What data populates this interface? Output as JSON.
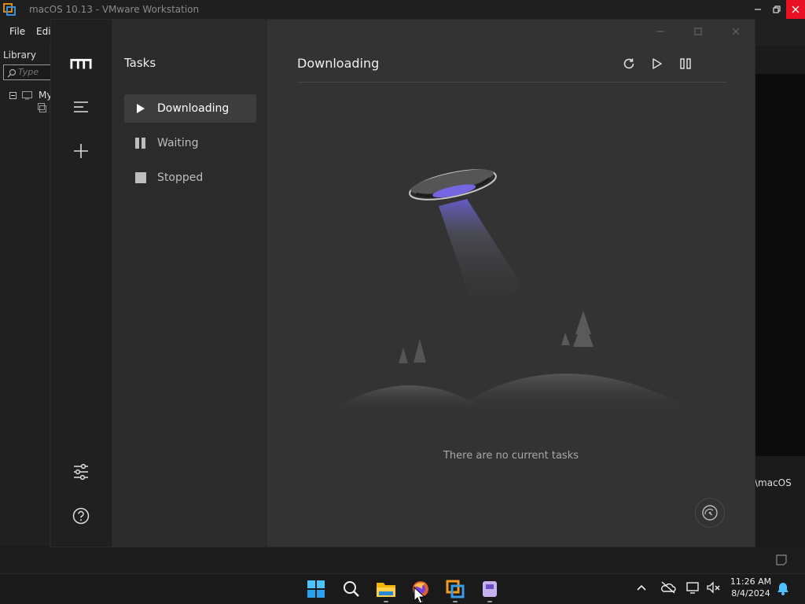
{
  "vmware": {
    "title": "macOS 10.13 - VMware Workstation",
    "menu": {
      "file": "File",
      "edit": "Edit"
    },
    "library_label": "Library",
    "search_placeholder": "Type",
    "tree_item": "My",
    "path_fragment": "\\macOS"
  },
  "app": {
    "window_controls": [
      "minimize",
      "maximize",
      "close"
    ],
    "sidebar_icons": [
      "logo-icon",
      "menu-icon",
      "add-task-icon",
      "preferences-icon",
      "help-icon"
    ],
    "tasks_title": "Tasks",
    "task_lists": [
      {
        "label": "Downloading",
        "icon": "play-icon",
        "active": true
      },
      {
        "label": "Waiting",
        "icon": "pause-icon",
        "active": false
      },
      {
        "label": "Stopped",
        "icon": "stop-icon",
        "active": false
      }
    ],
    "main_title": "Downloading",
    "toolbar": [
      "refresh-icon",
      "resume-all-icon",
      "pause-all-icon"
    ],
    "empty_message": "There are no current tasks",
    "speedometer_icon": "speedometer-icon"
  },
  "taskbar": {
    "apps": [
      "windows-start-icon",
      "search-icon",
      "file-explorer-icon",
      "firefox-icon",
      "vmware-icon",
      "app-icon"
    ],
    "time": "11:26 AM",
    "date": "8/4/2024"
  },
  "colors": {
    "rail": "#202020",
    "task_panel": "#2b2b2b",
    "main": "#333333",
    "close_red": "#e81123"
  }
}
